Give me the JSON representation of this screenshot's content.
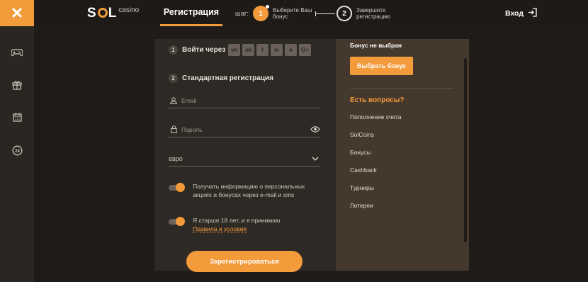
{
  "header": {
    "close_label": "✕",
    "logo_text_a": "S",
    "logo_text_b": "L",
    "logo_suffix": "casino",
    "title": "Регистрация",
    "steps_word": "шаг:",
    "step1_num": "1",
    "step1_text": "Выберите Ваш бонус",
    "step2_num": "2",
    "step2_text": "Завершите регистрацию",
    "login_label": "Вход",
    "login_icon": "login-arrow-icon"
  },
  "rail": {
    "icons": [
      "gamepad-icon",
      "gift-icon",
      "calendar-icon",
      "support-24-icon"
    ]
  },
  "form": {
    "section1_num": "1",
    "section1_label": "Войти через",
    "socials": [
      "vk",
      "ok",
      "f",
      "m",
      "я",
      "G+"
    ],
    "section2_num": "2",
    "section2_label": "Стандартная регистрация",
    "email_placeholder": "Email",
    "password_placeholder": "Пароль",
    "currency_value": "евро",
    "newsletter_text": "Получать информацию о персональных акциях и бонусах через e-mail и sms",
    "age_text": "Я старше 18 лет, и я принимаю",
    "terms_link": "Правила и условия",
    "register_label": "Зарегистрироваться"
  },
  "side": {
    "bonus_title": "Бонус не выбран",
    "bonus_button": "Выбрать бонус",
    "faq_title": "Есть вопросы?",
    "faq_items": [
      "Пополнение счета",
      "SolCoins",
      "Бонусы",
      "Cashback",
      "Турниры",
      "Лотереи"
    ]
  },
  "colors": {
    "accent": "#f39a3b",
    "panel_dark": "#2d2925",
    "panel_brown": "#45392d",
    "background": "#1e1b18"
  }
}
